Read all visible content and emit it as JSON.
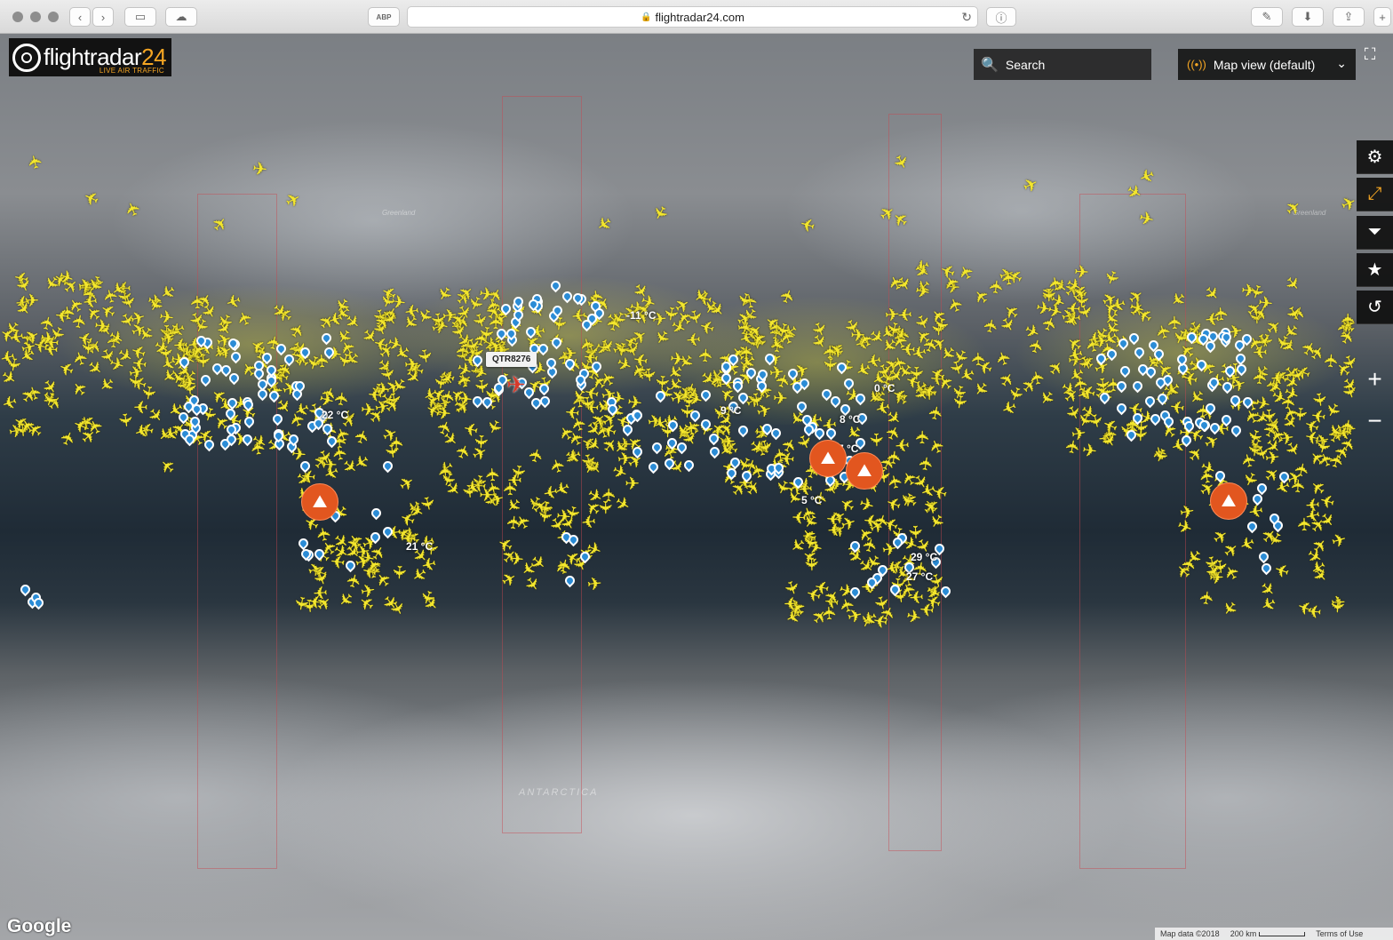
{
  "browser": {
    "url": "flightradar24.com",
    "abp_label": "ABP"
  },
  "app": {
    "logo_name": "flightradar",
    "logo_num": "24",
    "logo_tag": "LIVE AIR TRAFFIC",
    "search_placeholder": "Search",
    "map_view_label": "Map view (default)"
  },
  "map": {
    "selected_callsign": "QTR8276",
    "labels": [
      "ANTARCTICA",
      "Greenland",
      "Greenland"
    ],
    "temperatures": [
      "-11 °C",
      "21 °C",
      "22 °C",
      "0 °C",
      "8 °C",
      "7 °C",
      "5 °C",
      "29 °C",
      "27 °C",
      "9 °C"
    ]
  },
  "footer": {
    "brand": "Google",
    "map_data": "Map data ©2018",
    "scale": "200 km",
    "terms": "Terms of Use"
  },
  "side_controls": [
    "settings-icon",
    "expand-icon",
    "filter-icon",
    "star-icon",
    "playback-icon"
  ],
  "colors": {
    "aircraft": "#f3e62d",
    "accent": "#f5a623",
    "airport_pin": "#2b8cd6",
    "volcano": "#e2561f"
  }
}
